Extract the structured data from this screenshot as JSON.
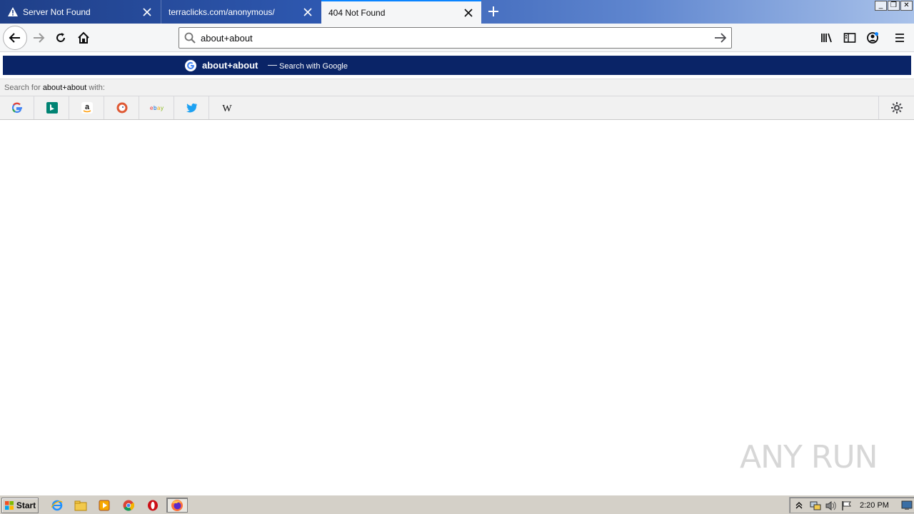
{
  "tabs": [
    {
      "label": "Server Not Found",
      "icon": "warning-icon"
    },
    {
      "label": "terraclicks.com/anonymous/",
      "icon": ""
    },
    {
      "label": "404 Not Found",
      "icon": ""
    }
  ],
  "urlbar": {
    "value": "about+about"
  },
  "suggestion": {
    "query": "about+about",
    "separator": "—",
    "action": "Search with Google"
  },
  "oneoff": {
    "prefix": "Search for ",
    "query": "about+about",
    "suffix": " with:"
  },
  "engines": [
    "google",
    "bing",
    "amazon",
    "duckduckgo",
    "ebay",
    "twitter",
    "wikipedia"
  ],
  "watermark": "ANY RUN",
  "taskbar": {
    "start_label": "Start",
    "clock": "2:20 PM"
  },
  "colors": {
    "suggest_bg": "#0a2467",
    "accent": "#0a84ff"
  }
}
